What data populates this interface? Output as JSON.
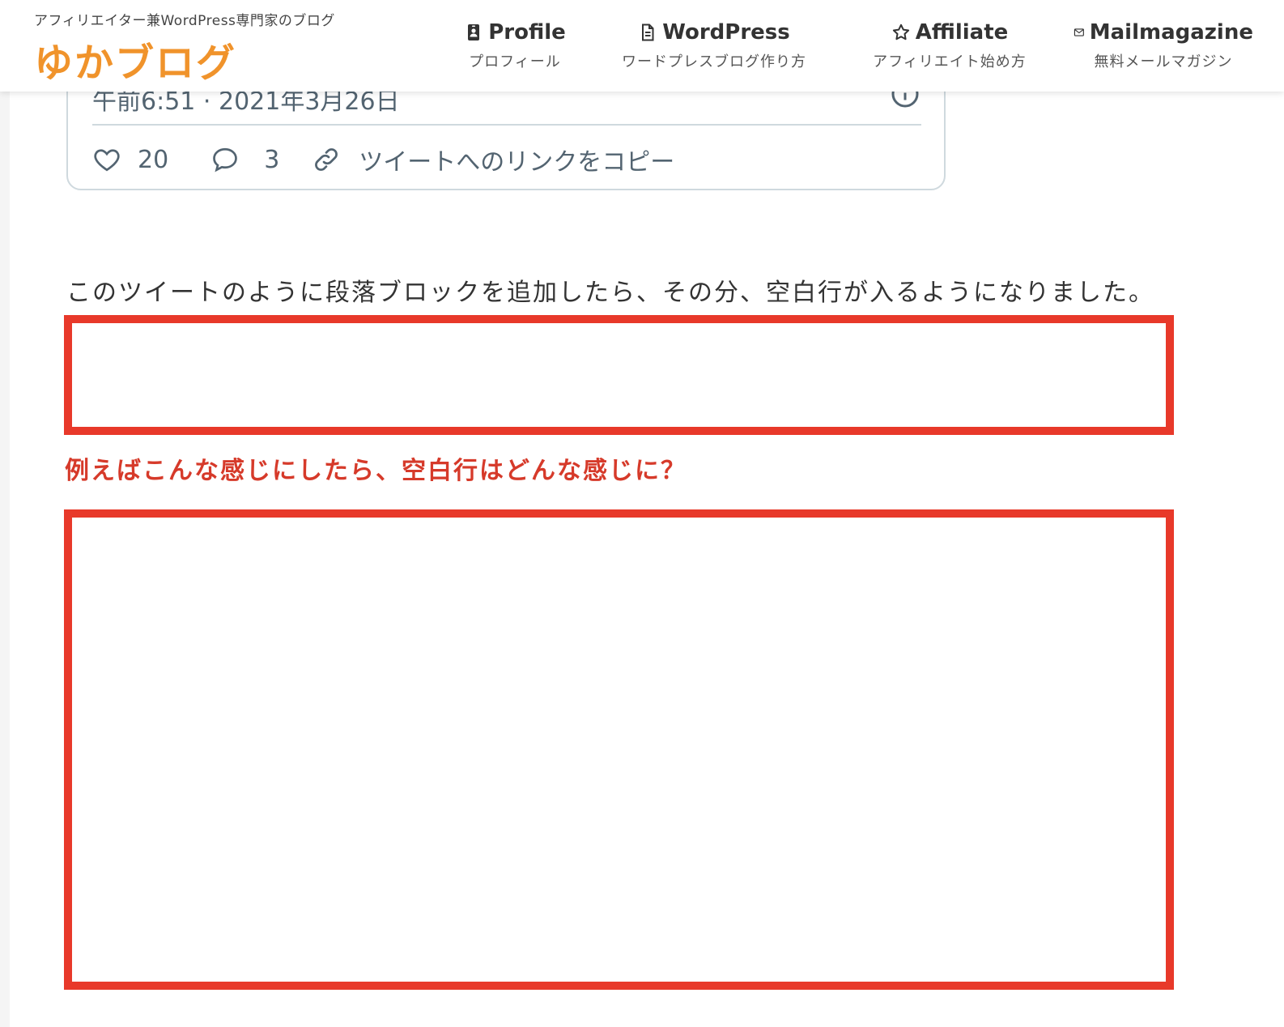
{
  "header": {
    "tagline": "アフィリエイター兼WordPress専門家のブログ",
    "site_title": "ゆかブログ",
    "nav": [
      {
        "label": "Profile",
        "sub": "プロフィール",
        "icon": "id-badge-icon"
      },
      {
        "label": "WordPress",
        "sub": "ワードプレスブログ作り方",
        "icon": "document-icon"
      },
      {
        "label": "Affiliate",
        "sub": "アフィリエイト始め方",
        "icon": "star-icon"
      },
      {
        "label": "Mailmagazine",
        "sub": "無料メールマガジン",
        "icon": "envelope-icon"
      }
    ]
  },
  "tweet": {
    "date": "午前6:51 · 2021年3月26日",
    "likes": "20",
    "replies": "3",
    "copy_link_label": "ツイートへのリンクをコピー"
  },
  "content": {
    "paragraph": "このツイートのように段落ブロックを追加したら、その分、空白行が入るようになりました。",
    "red_heading": "例えばこんな感じにしたら、空白行はどんな感じに？"
  },
  "colors": {
    "accent_orange": "#f0932b",
    "highlight_red": "#e8392a",
    "heading_red": "#d63a2a",
    "twitter_gray": "#536471"
  }
}
